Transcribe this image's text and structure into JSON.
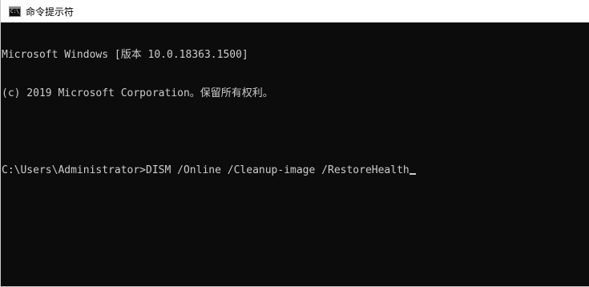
{
  "window": {
    "title": "命令提示符",
    "icon": "console-icon",
    "icon_text": "C:\\_"
  },
  "console": {
    "lines": [
      "Microsoft Windows [版本 10.0.18363.1500]",
      "(c) 2019 Microsoft Corporation。保留所有权利。",
      "",
      "C:\\Users\\Administrator>DISM /Online /Cleanup-image /RestoreHealth"
    ]
  },
  "colors": {
    "console_background": "#0c0c0c",
    "console_text": "#cccccc",
    "titlebar_background": "#ffffff"
  }
}
